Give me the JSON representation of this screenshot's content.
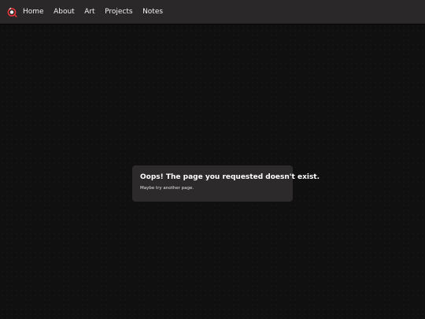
{
  "nav": {
    "logo_icon": "red-orb-logo-icon",
    "links": [
      {
        "label": "Home"
      },
      {
        "label": "About"
      },
      {
        "label": "Art"
      },
      {
        "label": "Projects"
      },
      {
        "label": "Notes"
      }
    ]
  },
  "error": {
    "title": "Oops! The page you requested doesn't exist.",
    "subtitle": "Maybe try another page."
  },
  "colors": {
    "background": "#101010",
    "navbar": "#2a2828",
    "card": "#2c2a2a",
    "logo_accent": "#e0343a"
  }
}
